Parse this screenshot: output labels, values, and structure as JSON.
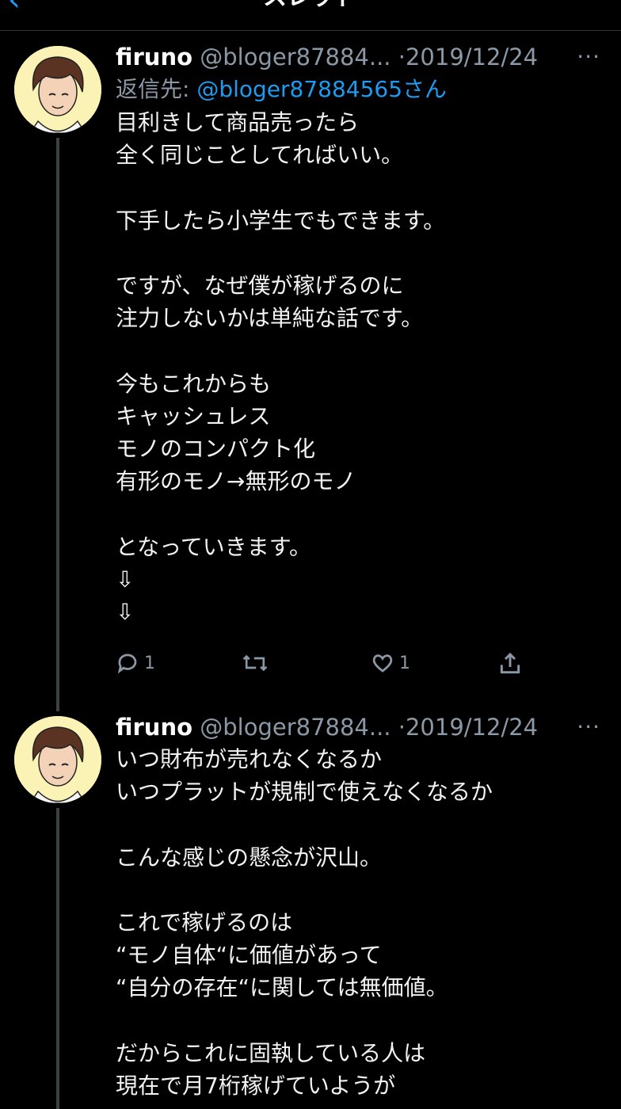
{
  "header": {
    "back_glyph": "‹",
    "title": "スレッド"
  },
  "tweets": [
    {
      "name": "firuno",
      "handle": "@bloger87884...",
      "dot": "·",
      "date": "2019/12/24",
      "more": "···",
      "reply_label": "返信先:",
      "reply_mention": "@bloger87884565さん",
      "text": "目利きして商品売ったら\n全く同じことしてればいい。\n\n下手したら小学生でもできます。\n\nですが、なぜ僕が稼げるのに\n注力しないかは単純な話です。\n\n今もこれからも\nキャッシュレス\nモノのコンパクト化\n有形のモノ→無形のモノ\n\nとなっていきます。\n⇩\n⇩",
      "reply_count": "1",
      "retweet_count": "",
      "like_count": "1"
    },
    {
      "name": "firuno",
      "handle": "@bloger87884...",
      "dot": "·",
      "date": "2019/12/24",
      "more": "···",
      "text": "いつ財布が売れなくなるか\nいつプラットが規制で使えなくなるか\n\nこんな感じの懸念が沢山。\n\nこれで稼げるのは\n“モノ自体“に価値があって\n“自分の存在“に関しては無価値。\n\nだからこれに固執している人は\n現在で月7桁稼げていようが"
    }
  ],
  "icons": [
    "back-icon",
    "reply-icon",
    "retweet-icon",
    "like-icon",
    "share-icon",
    "more-icon"
  ],
  "colors": {
    "background": "#000000",
    "accent": "#1d9bf0",
    "secondary_text": "#8b98a5",
    "avatar_bg": "#fbf3b5"
  }
}
